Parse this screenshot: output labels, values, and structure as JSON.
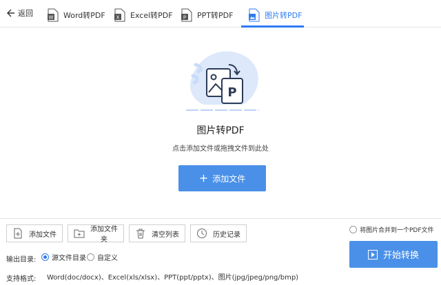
{
  "nav": {
    "back_label": "返回",
    "tabs": [
      {
        "label": "Word转PDF",
        "icon": "word-doc-icon"
      },
      {
        "label": "Excel转PDF",
        "icon": "excel-doc-icon"
      },
      {
        "label": "PPT转PDF",
        "icon": "ppt-doc-icon"
      },
      {
        "label": "图片转PDF",
        "icon": "image-doc-icon",
        "active": true
      }
    ]
  },
  "main": {
    "title": "图片转PDF",
    "subtitle": "点击添加文件或拖拽文件到此处",
    "add_button_label": "添加文件",
    "hero_icon": "image-to-pdf-icon"
  },
  "toolbar": {
    "add_file": "添加文件",
    "add_folder": "添加文件夹",
    "clear_list": "清空列表",
    "history": "历史记录"
  },
  "options": {
    "merge_label": "将图片合并到一个PDF文件",
    "merge_checked": false,
    "output_label": "输出目录:",
    "source_dir_label": "源文件目录",
    "source_dir_selected": true,
    "custom_label": "自定义",
    "custom_selected": false,
    "start_label": "开始转换",
    "formats_label": "支持格式:",
    "formats_value": "Word(doc/docx)、Excel(xls/xlsx)、PPT(ppt/pptx)、图片(jpg/jpeg/png/bmp)"
  },
  "colors": {
    "accent": "#2e7bf2",
    "button": "#4a90e8",
    "hero_blob": "#dde8fb"
  }
}
